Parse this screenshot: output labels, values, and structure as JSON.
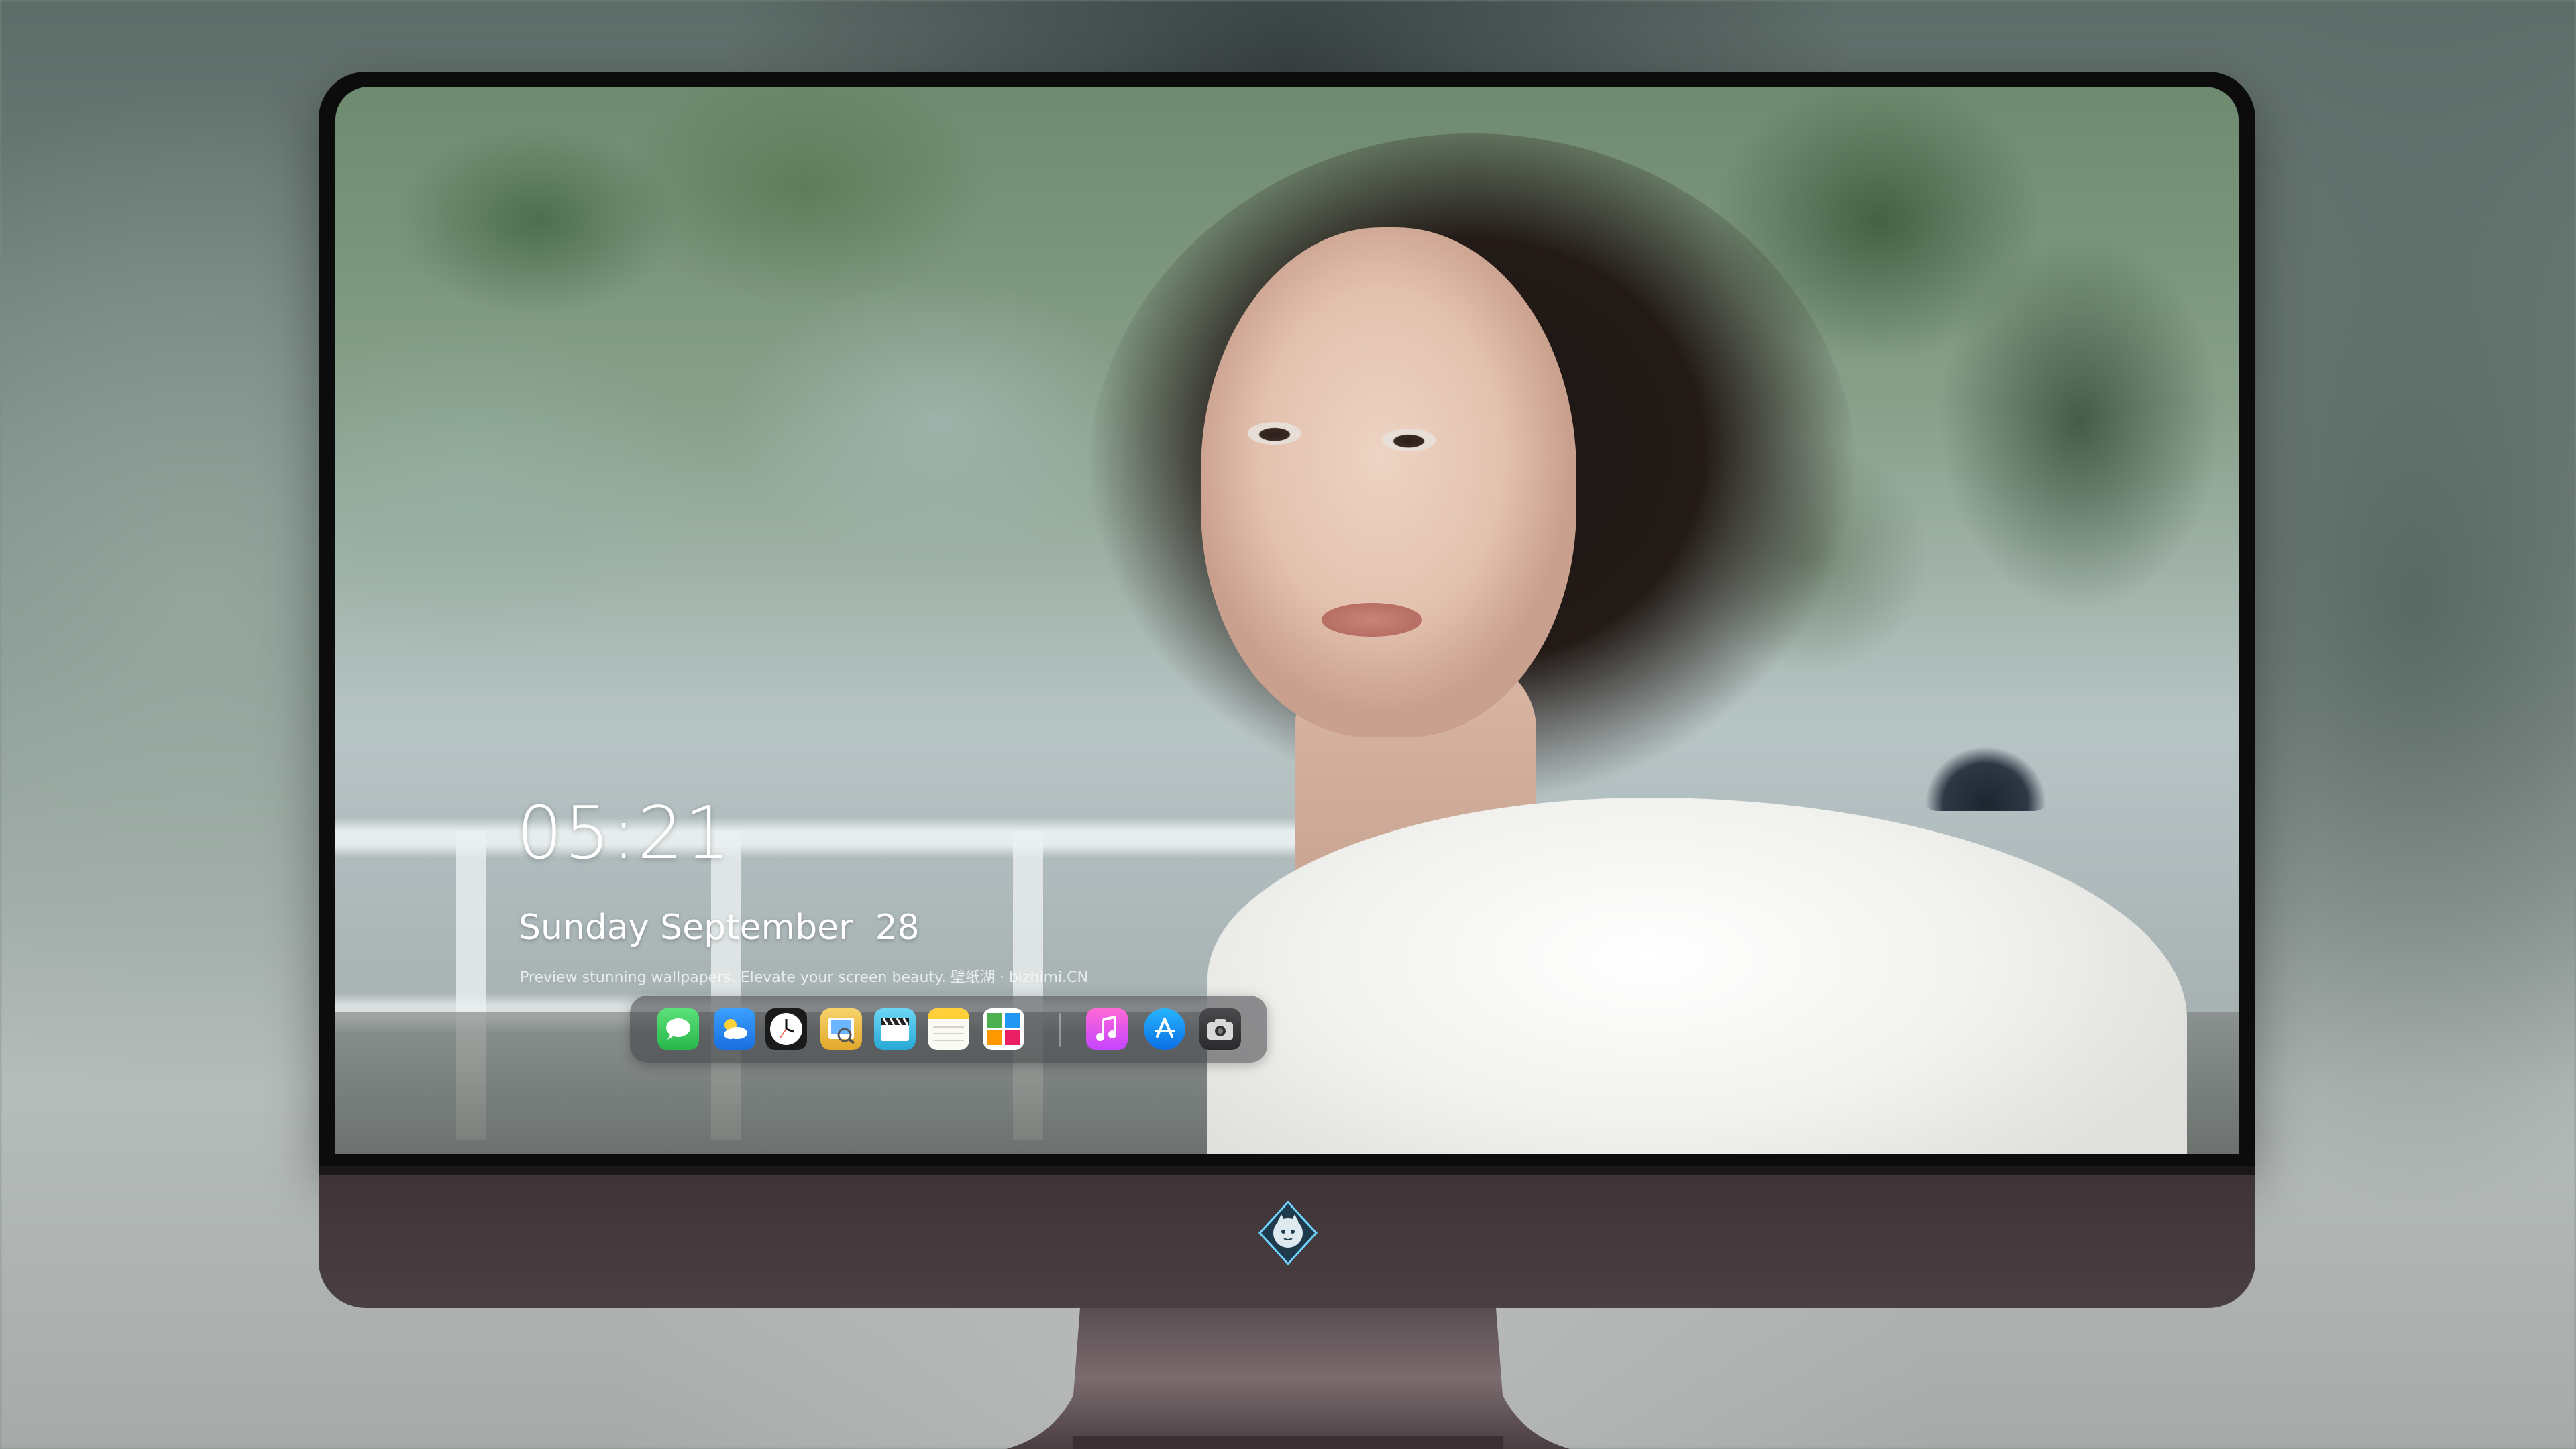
{
  "lockscreen": {
    "time": "05:21",
    "date": "Sunday September  28",
    "tagline": "Preview stunning wallpapers. Elevate your screen beauty. 壁纸湖 · bizhimi.CN"
  },
  "dock": {
    "apps": [
      {
        "name": "Messages",
        "icon": "messages-icon",
        "color": "#33c759"
      },
      {
        "name": "Weather",
        "icon": "weather-icon",
        "color": "#2f8cf5"
      },
      {
        "name": "Clock",
        "icon": "clock-icon",
        "color": "#111111"
      },
      {
        "name": "Preview",
        "icon": "preview-icon",
        "color": "#f0c040"
      },
      {
        "name": "Clips",
        "icon": "clapperboard-icon",
        "color": "#4fc3e8"
      },
      {
        "name": "Notes",
        "icon": "notes-icon",
        "color": "#ffd54a"
      },
      {
        "name": "Photo Booth",
        "icon": "photo-grid-icon",
        "color": "#e74c3c"
      },
      {
        "name": "Music",
        "icon": "music-icon",
        "color": "#fb5bc5"
      },
      {
        "name": "App Store",
        "icon": "app-store-icon",
        "color": "#1a8cff"
      },
      {
        "name": "Screenshot",
        "icon": "camera-icon",
        "color": "#3a3a3c"
      }
    ]
  },
  "colors": {
    "bezel": "#0d0c0d",
    "chin": "#433a3d",
    "dock_bg": "#3c3c41"
  }
}
